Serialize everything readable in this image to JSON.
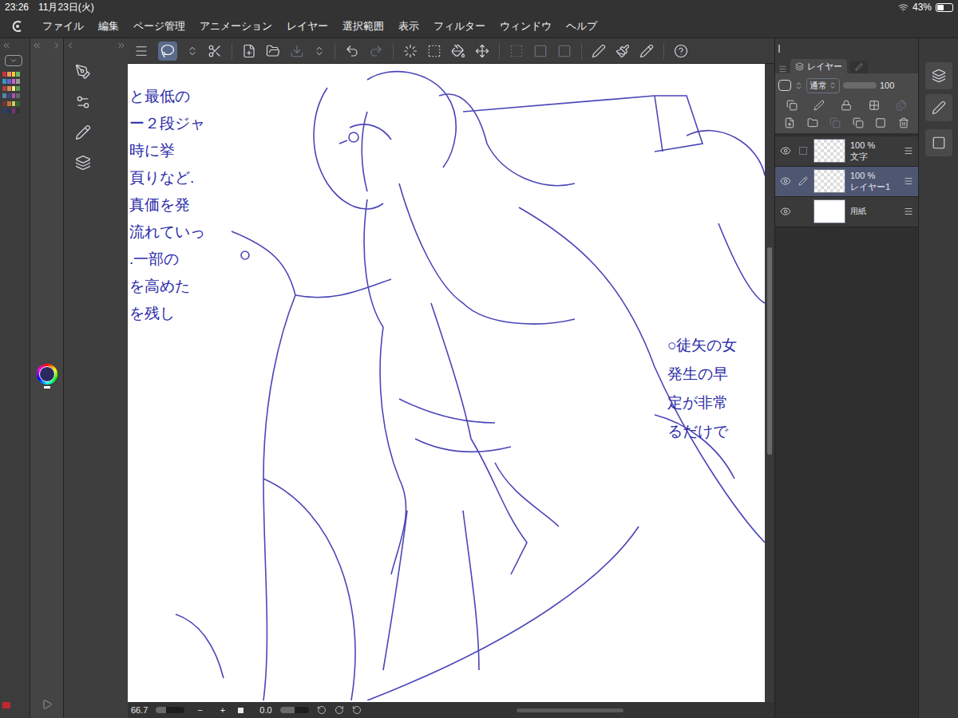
{
  "status_bar": {
    "time": "23:26",
    "date": "11月23日(火)",
    "battery": "43%",
    "battery_level": 0.43
  },
  "menu": [
    "ファイル",
    "編集",
    "ページ管理",
    "アニメーション",
    "レイヤー",
    "選択範囲",
    "表示",
    "フィルター",
    "ウィンドウ",
    "ヘルプ"
  ],
  "canvas": {
    "notes_left": [
      "と最低の",
      "ー２段ジャ",
      "時に挙",
      "頁りなど.",
      "真価を発",
      "流れていっ",
      ".一部の",
      "を高めた",
      "を残し"
    ],
    "notes_right": [
      "○徒矢の女",
      "発生の早",
      "定が非常",
      "るだけで"
    ]
  },
  "bottom_bar": {
    "zoom": "66.7",
    "zoom_level": 0.35,
    "minus": "−",
    "plus": "+",
    "angle": "0.0",
    "angle_level": 0.5
  },
  "layer_panel": {
    "tab": "レイヤー",
    "blend": "通常",
    "opacity": "100",
    "opacity_level": 1,
    "layers": [
      {
        "opacity": "100 %",
        "name": "文字",
        "visible": true,
        "selected": false,
        "editing": false,
        "kind": "raster"
      },
      {
        "opacity": "100 %",
        "name": "レイヤー1",
        "visible": true,
        "selected": true,
        "editing": true,
        "kind": "raster"
      },
      {
        "opacity": "",
        "name": "用紙",
        "visible": true,
        "selected": false,
        "editing": false,
        "kind": "paper"
      }
    ]
  }
}
